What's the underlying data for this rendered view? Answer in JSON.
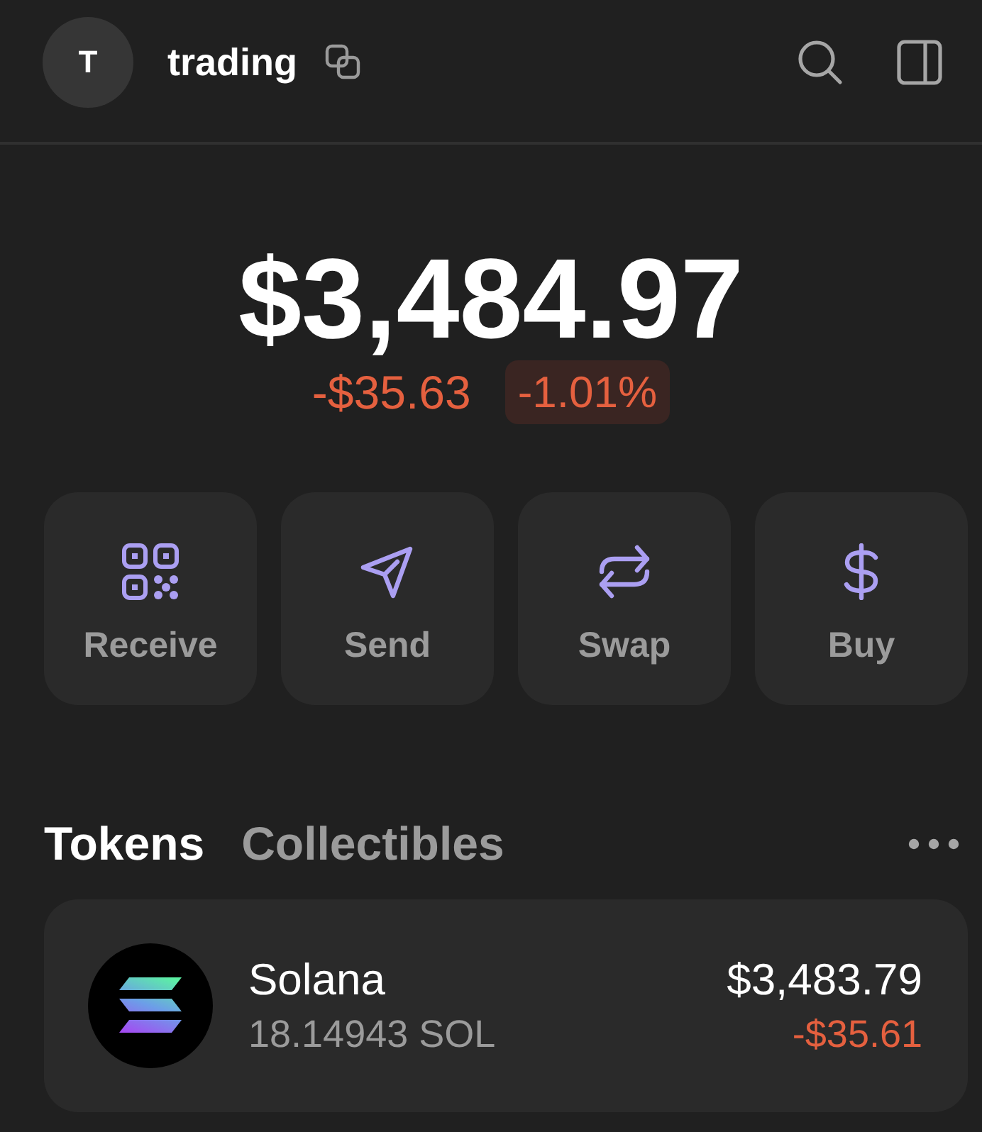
{
  "header": {
    "avatar_initial": "T",
    "account_name": "trading"
  },
  "balance": {
    "total": "$3,484.97",
    "change_amount": "-$35.63",
    "change_percent": "-1.01%",
    "negative": true
  },
  "actions": [
    {
      "label": "Receive",
      "kind": "receive"
    },
    {
      "label": "Send",
      "kind": "send"
    },
    {
      "label": "Swap",
      "kind": "swap"
    },
    {
      "label": "Buy",
      "kind": "buy"
    }
  ],
  "tabs": [
    {
      "label": "Tokens",
      "selected": true
    },
    {
      "label": "Collectibles",
      "selected": false
    }
  ],
  "tokens": [
    {
      "name": "Solana",
      "amount": "18.14943 SOL",
      "value": "$3,483.79",
      "change": "-$35.61",
      "negative": true
    }
  ]
}
